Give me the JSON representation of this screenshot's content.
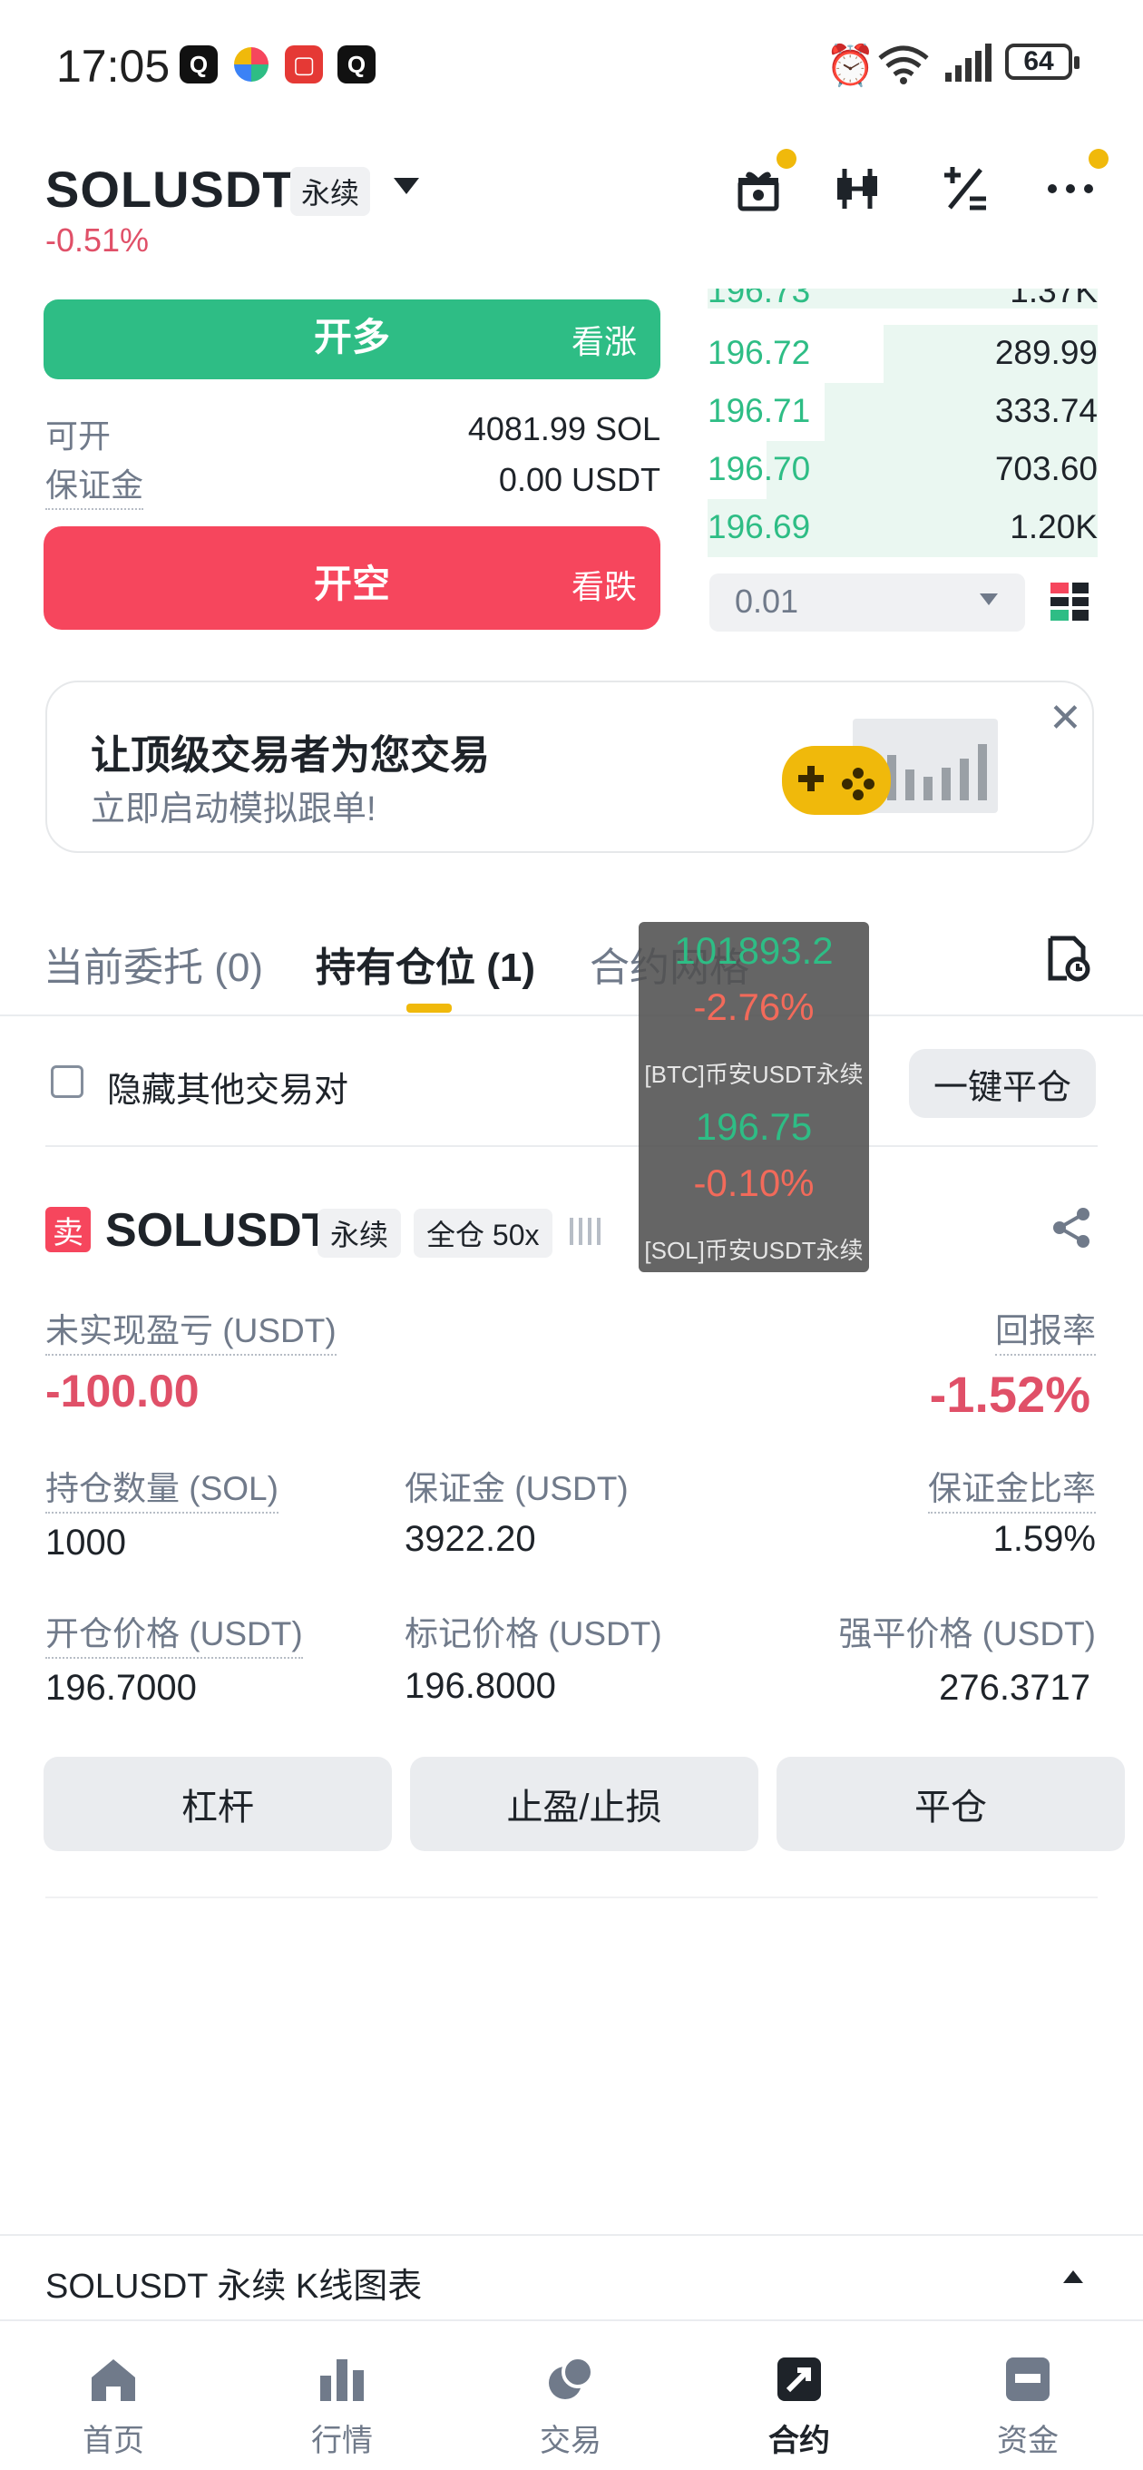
{
  "status_bar": {
    "time": "17:05",
    "battery": "64"
  },
  "header": {
    "symbol": "SOLUSDT",
    "contract_type": "永续",
    "change": "-0.51%"
  },
  "order_panel": {
    "long_button": "开多",
    "long_sub": "看涨",
    "short_button": "开空",
    "short_sub": "看跌",
    "available_label": "可开",
    "available_value": "4081.99 SOL",
    "margin_label": "保证金",
    "margin_value": "0.00 USDT"
  },
  "order_book": {
    "partial_top": {
      "price": "196.73",
      "qty": "1.37K"
    },
    "rows": [
      {
        "price": "196.72",
        "qty": "289.99",
        "depth": 0.55
      },
      {
        "price": "196.71",
        "qty": "333.74",
        "depth": 0.7
      },
      {
        "price": "196.70",
        "qty": "703.60",
        "depth": 0.85
      },
      {
        "price": "196.69",
        "qty": "1.20K",
        "depth": 1.0
      }
    ],
    "precision": "0.01"
  },
  "banner": {
    "title": "让顶级交易者为您交易",
    "subtitle": "立即启动模拟跟单!"
  },
  "tabs": {
    "open_orders": "当前委托 (0)",
    "positions": "持有仓位 (1)",
    "grid": "合约网格"
  },
  "filters": {
    "hide_others": "隐藏其他交易对",
    "close_all": "一键平仓"
  },
  "position": {
    "side": "卖",
    "symbol": "SOLUSDT",
    "type": "永续",
    "mode": "全仓 50x",
    "unrealized_pnl_label": "未实现盈亏 (USDT)",
    "unrealized_pnl": "-100.00",
    "roe_label": "回报率",
    "roe": "-1.52%",
    "size_label": "持仓数量 (SOL)",
    "size": "1000",
    "margin_label": "保证金 (USDT)",
    "margin": "3922.20",
    "margin_ratio_label": "保证金比率",
    "margin_ratio": "1.59%",
    "entry_label": "开仓价格 (USDT)",
    "entry": "196.7000",
    "mark_label": "标记价格 (USDT)",
    "mark": "196.8000",
    "liq_label": "强平价格 (USDT)",
    "liq": "276.3717",
    "btn_leverage": "杠杆",
    "btn_tpsl": "止盈/止损",
    "btn_close": "平仓"
  },
  "overlay": {
    "btc_price": "101893.2",
    "btc_change": "-2.76%",
    "btc_name": "[BTC]币安USDT永续",
    "sol_price": "196.75",
    "sol_change": "-0.10%",
    "sol_name": "[SOL]币安USDT永续"
  },
  "kline_bar": {
    "label": "SOLUSDT 永续 K线图表"
  },
  "nav": {
    "home": "首页",
    "markets": "行情",
    "trade": "交易",
    "futures": "合约",
    "assets": "资金"
  },
  "colors": {
    "green": "#2ebd85",
    "red": "#f6465d",
    "accent": "#f0b90b"
  }
}
